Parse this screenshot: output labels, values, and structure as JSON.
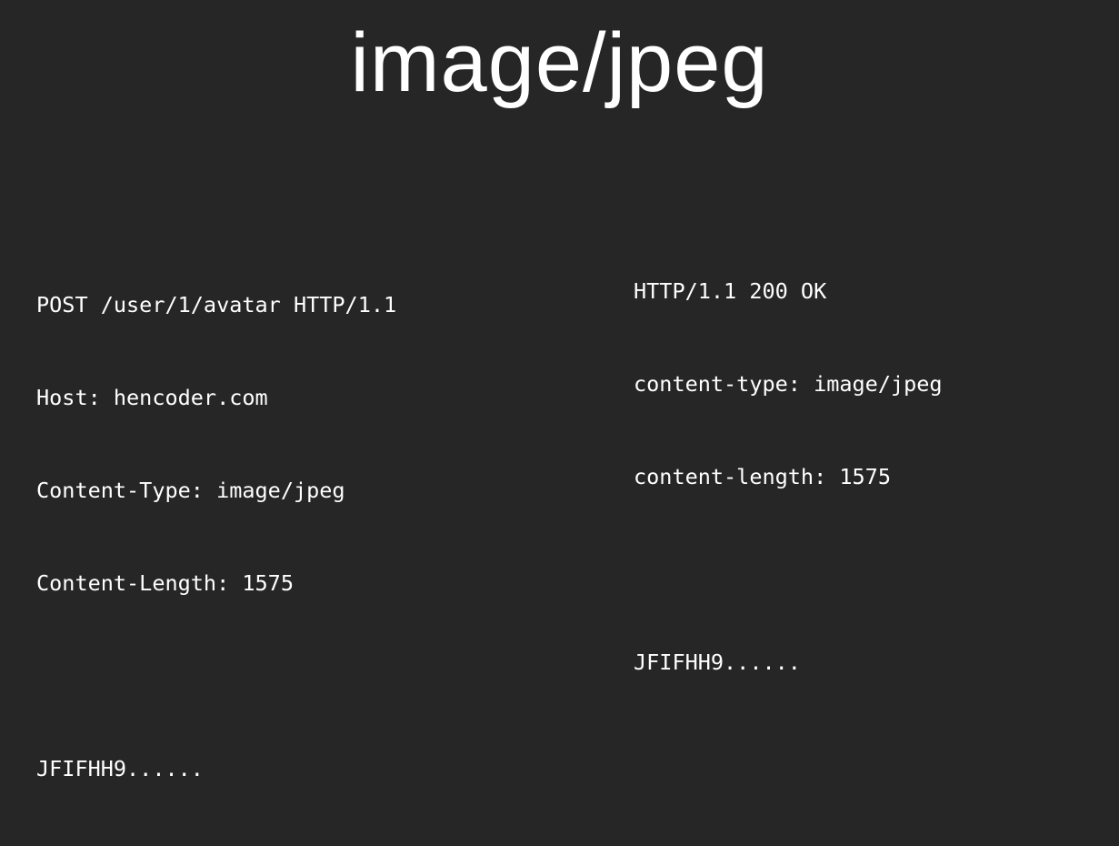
{
  "slide": {
    "title": "image/jpeg"
  },
  "request": {
    "lines": [
      "POST /user/1/avatar HTTP/1.1",
      "Host: hencoder.com",
      "Content-Type: image/jpeg",
      "Content-Length: 1575"
    ],
    "body": "JFIFHH9......"
  },
  "response": {
    "lines": [
      "HTTP/1.1 200 OK",
      "content-type: image/jpeg",
      "content-length: 1575"
    ],
    "body": "JFIFHH9......"
  },
  "colors": {
    "background": "#262626",
    "text": "#ffffff"
  }
}
